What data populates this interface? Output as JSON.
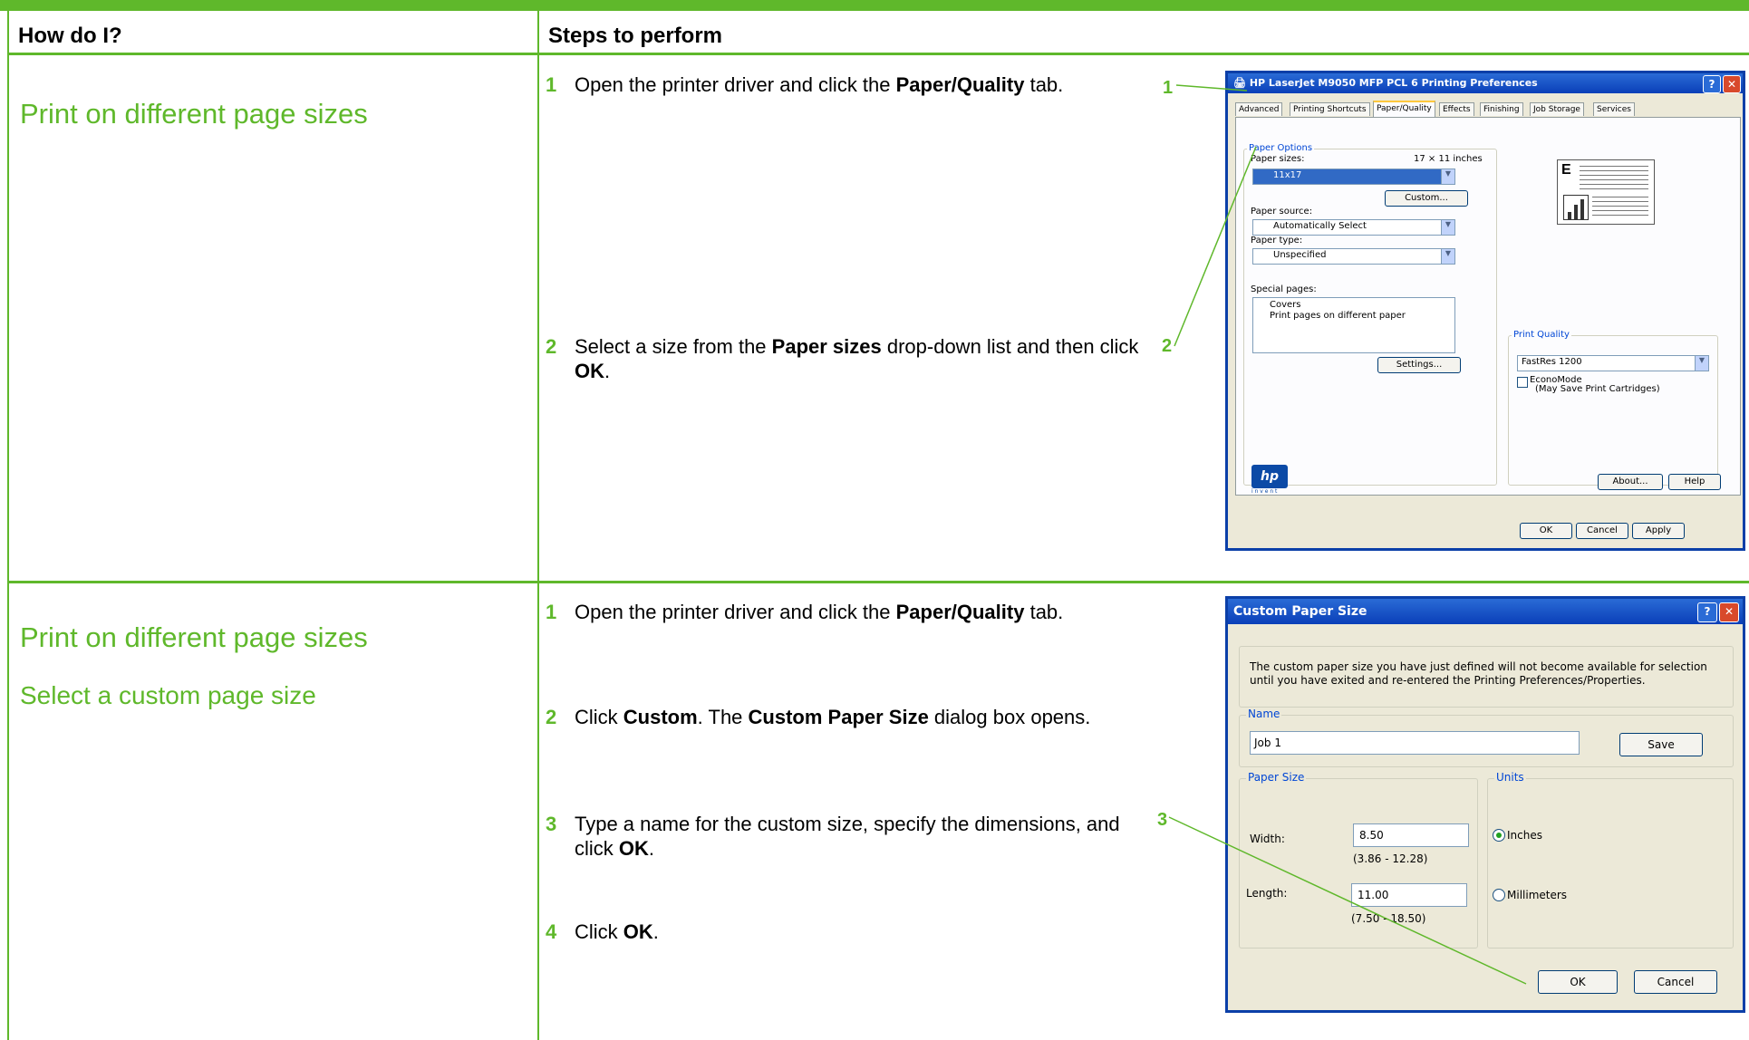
{
  "table": {
    "col1_header": "How do I?",
    "col2_header": "Steps to perform"
  },
  "section1": {
    "task": "Print on different page sizes",
    "steps": [
      {
        "num": "1",
        "pre": "Open the printer driver and click the ",
        "bold": "Paper/Quality",
        "post": " tab."
      },
      {
        "num": "2",
        "pre": "Select a size from the ",
        "bold": "Paper sizes",
        "post": " drop-down list and then click ",
        "bold2": "OK",
        "post2": "."
      }
    ],
    "callouts": [
      "1",
      "2"
    ]
  },
  "section2": {
    "task": "Print on different page sizes",
    "subtask": "Select a custom page size",
    "steps": [
      {
        "num": "1",
        "pre": "Open the printer driver and click the ",
        "bold": "Paper/Quality",
        "post": " tab."
      },
      {
        "num": "2",
        "pre": "Click ",
        "bold": "Custom",
        "mid": ". The ",
        "bold2": "Custom Paper Size",
        "post": " dialog box opens."
      },
      {
        "num": "3",
        "pre": "Type a name for the custom size, specify the dimensions, and click ",
        "bold": "OK",
        "post": "."
      },
      {
        "num": "4",
        "pre": "Click ",
        "bold": "OK",
        "post": "."
      }
    ],
    "callout": "3"
  },
  "prefs_dialog": {
    "title": "HP LaserJet M9050 MFP PCL 6 Printing Preferences",
    "tabs": [
      "Advanced",
      "Printing Shortcuts",
      "Paper/Quality",
      "Effects",
      "Finishing",
      "Job Storage",
      "Services"
    ],
    "active_tab": "Paper/Quality",
    "paper_options_label": "Paper Options",
    "paper_sizes_label": "Paper sizes:",
    "paper_size_dims": "17 × 11 inches",
    "paper_size_value": "11x17",
    "custom_button": "Custom...",
    "paper_source_label": "Paper source:",
    "paper_source_value": "Automatically Select",
    "paper_type_label": "Paper type:",
    "paper_type_value": "Unspecified",
    "special_pages_label": "Special pages:",
    "special_pages_items": [
      "Covers",
      "Print pages on different paper"
    ],
    "settings_button": "Settings...",
    "print_quality_label": "Print Quality",
    "print_quality_value": "FastRes 1200",
    "economode_label": "EconoMode",
    "economode_note": "(May Save Print Cartridges)",
    "logo_text": "hp",
    "logo_tagline": "i n v e n t",
    "about_button": "About...",
    "help_button": "Help",
    "ok_button": "OK",
    "cancel_button": "Cancel",
    "apply_button": "Apply"
  },
  "custom_dialog": {
    "title": "Custom Paper Size",
    "info": "The custom paper size you have just defined will not become available for selection until you have exited and re-entered the Printing Preferences/Properties.",
    "name_label": "Name",
    "name_value": "Job 1",
    "save_button": "Save",
    "paper_size_label": "Paper Size",
    "width_label": "Width:",
    "width_value": "8.50",
    "width_range": "(3.86 - 12.28)",
    "length_label": "Length:",
    "length_value": "11.00",
    "length_range": "(7.50 - 18.50)",
    "units_label": "Units",
    "unit_inches": "Inches",
    "unit_mm": "Millimeters",
    "ok_button": "OK",
    "cancel_button": "Cancel"
  }
}
